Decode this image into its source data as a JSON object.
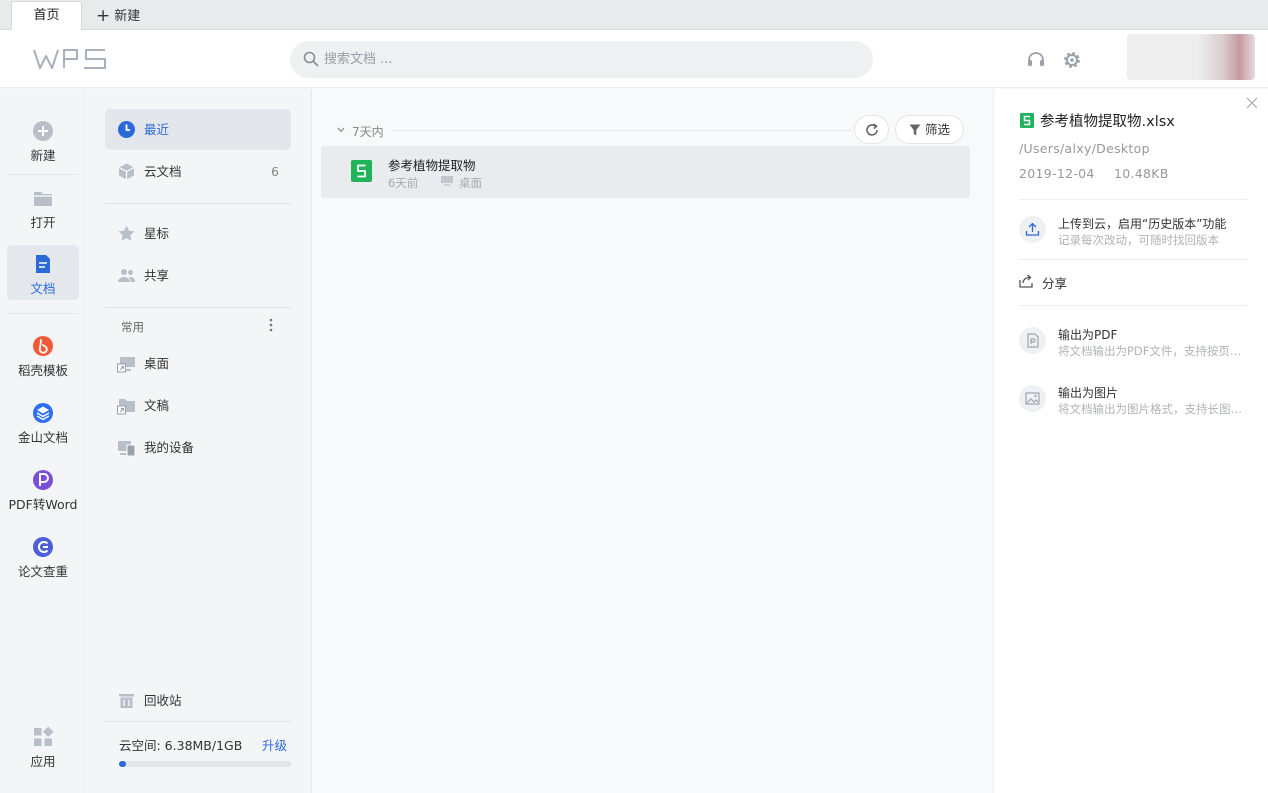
{
  "tabs": {
    "home": "首页",
    "new": "新建"
  },
  "header": {
    "logo": "WPS",
    "search_placeholder": "搜索文档 ..."
  },
  "rail": [
    {
      "label": "新建",
      "icon": "plus-circle-icon"
    },
    {
      "label": "打开",
      "icon": "folder-icon"
    },
    {
      "label": "文档",
      "icon": "document-icon",
      "active": true
    },
    {
      "label": "稻壳模板",
      "icon": "daoke-icon"
    },
    {
      "label": "金山文档",
      "icon": "kingsoft-docs-icon"
    },
    {
      "label": "PDF转Word",
      "icon": "pdf-to-word-icon"
    },
    {
      "label": "论文查重",
      "icon": "paper-check-icon"
    },
    {
      "label": "应用",
      "icon": "apps-icon"
    }
  ],
  "nav": {
    "recent": "最近",
    "cloud": "云文档",
    "cloud_count": "6",
    "starred": "星标",
    "shared": "共享",
    "section": "常用",
    "desktop": "桌面",
    "drafts": "文稿",
    "devices": "我的设备",
    "trash": "回收站",
    "quota": "云空间: 6.38MB/1GB",
    "upgrade": "升级",
    "quota_fraction": 0.0062
  },
  "main": {
    "group": "7天内",
    "filter": "筛选",
    "files": [
      {
        "name": "参考植物提取物",
        "time": "6天前",
        "location": "桌面"
      }
    ]
  },
  "detail": {
    "title": "参考植物提取物.xlsx",
    "path": "/Users/alxy/Desktop",
    "date": "2019-12-04",
    "size": "10.48KB",
    "upload_title": "上传到云，启用“历史版本”功能",
    "upload_sub": "记录每次改动，可随时找回版本",
    "share": "分享",
    "pdf_title": "输出为PDF",
    "pdf_sub": "将文档输出为PDF文件，支持按页…",
    "img_title": "输出为图片",
    "img_sub": "将文档输出为图片格式，支持长图…"
  },
  "colors": {
    "accent": "#2a6bd8",
    "excel": "#1fb45a",
    "daoke": "#f05a37",
    "kingsoft": "#2e6ff0",
    "pdf": "#7a4fd6"
  }
}
